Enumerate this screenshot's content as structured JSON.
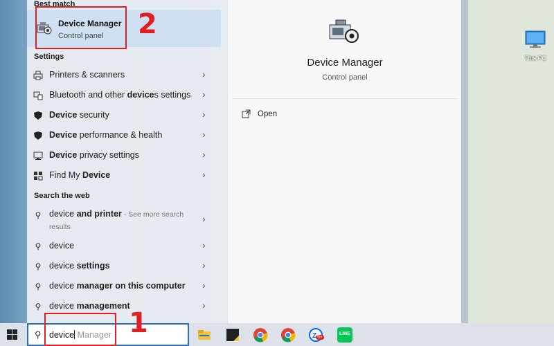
{
  "desktop": {
    "this_pc_label": "This PC"
  },
  "start_menu": {
    "best_match": {
      "section_title": "Best match",
      "title": "Device Manager",
      "subtitle": "Control panel"
    },
    "settings": {
      "section_title": "Settings",
      "items": [
        {
          "icon": "printer-icon",
          "label": "Printers & scanners"
        },
        {
          "icon": "bluetooth-icon",
          "pre": "Bluetooth and other ",
          "bold": "device",
          "post": "s settings"
        },
        {
          "icon": "shield-icon",
          "bold": "Device",
          "post": " security"
        },
        {
          "icon": "shield-icon",
          "bold": "Device",
          "post": " performance & health"
        },
        {
          "icon": "privacy-icon",
          "bold": "Device",
          "post": " privacy settings"
        },
        {
          "icon": "find-device-icon",
          "pre": "Find My ",
          "bold": "Device"
        }
      ]
    },
    "web": {
      "section_title": "Search the web",
      "items": [
        {
          "pre": "device ",
          "bold": "and printer",
          "post": " - See more search results"
        },
        {
          "pre": "device"
        },
        {
          "pre": "device ",
          "bold": "settings"
        },
        {
          "pre": "device ",
          "bold": "manager on this computer"
        },
        {
          "pre": "device ",
          "bold": "management"
        }
      ]
    },
    "preview": {
      "title": "Device Manager",
      "subtitle": "Control panel",
      "action_label": "Open"
    }
  },
  "taskbar": {
    "search_query": "device",
    "search_autocomplete": " Manager",
    "apps": [
      "file-explorer-icon",
      "sticky-notes-icon",
      "chrome-icon",
      "chrome-icon",
      "zalo-icon",
      "line-icon"
    ],
    "zalo_badge": "5+",
    "line_label": "LINE"
  },
  "annotations": {
    "step1": "1",
    "step2": "2"
  },
  "colors": {
    "highlight": "#cfe0f3",
    "accent": "#2b6cc4",
    "annotation_red": "#e02020"
  }
}
